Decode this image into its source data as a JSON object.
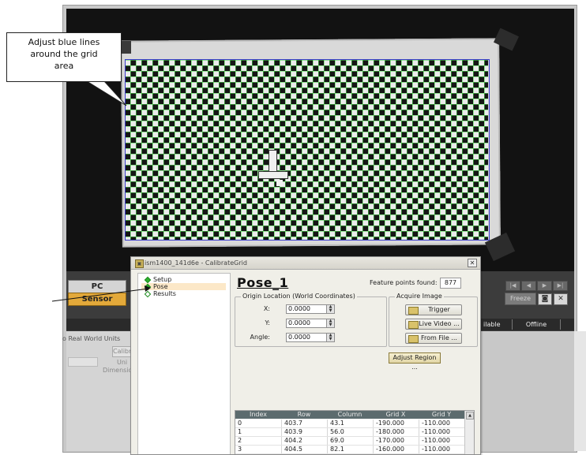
{
  "callout": {
    "lines": [
      "Adjust blue lines",
      "around the grid",
      "area"
    ]
  },
  "background_app": {
    "pc_label": "PC",
    "sensor_label": "Sensor",
    "freeze_label": "Freeze",
    "status_available": "ilable",
    "status_offline": "Offline",
    "settings_heading": "o Real World Units",
    "settings_calib_label": "Calibr",
    "settings_units_label": "Uni",
    "settings_dims_label": "Dimensio",
    "sensor_color": "#e3a93a"
  },
  "dialog": {
    "title": "ism1400_141d6e - CalibrateGrid",
    "close_label": "✕",
    "tree": [
      {
        "label": "Setup",
        "state": "complete"
      },
      {
        "label": "Pose",
        "state": "active"
      },
      {
        "label": "Results",
        "state": "pending"
      }
    ],
    "pose_title": "Pose_1",
    "feature_points_label": "Feature points found:",
    "feature_points_value": "877",
    "origin": {
      "legend": "Origin Location (World Coordinates)",
      "x_label": "X:",
      "x_value": "0.0000",
      "y_label": "Y:",
      "y_value": "0.0000",
      "angle_label": "Angle:",
      "angle_value": "0.0000"
    },
    "acquire": {
      "legend": "Acquire Image",
      "trigger_label": "Trigger",
      "live_video_label": "Live Video ...",
      "from_file_label": "From File ..."
    },
    "adjust_region_label": "Adjust Region ...",
    "table": {
      "columns": [
        "Index",
        "Row",
        "Column",
        "Grid X",
        "Grid Y"
      ],
      "rows": [
        [
          "0",
          "403.7",
          "43.1",
          "-190.000",
          "-110.000"
        ],
        [
          "1",
          "403.9",
          "56.0",
          "-180.000",
          "-110.000"
        ],
        [
          "2",
          "404.2",
          "69.0",
          "-170.000",
          "-110.000"
        ],
        [
          "3",
          "404.5",
          "82.1",
          "-160.000",
          "-110.000"
        ]
      ]
    }
  }
}
